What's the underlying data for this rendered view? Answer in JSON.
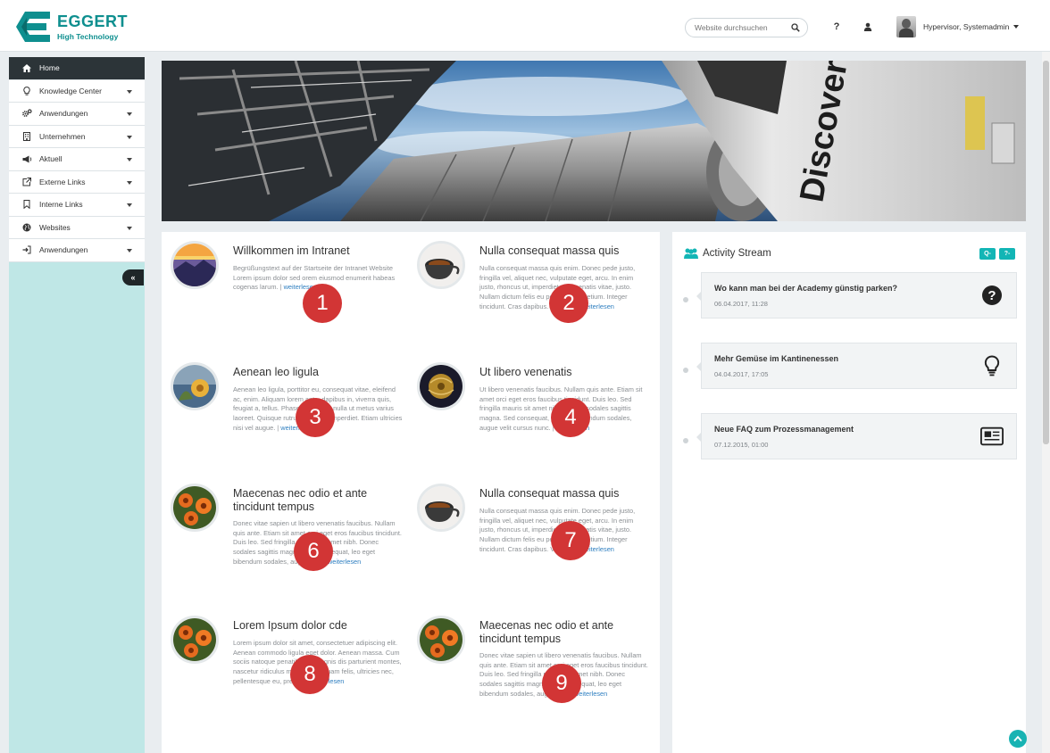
{
  "brand": {
    "name": "EGGERT",
    "tagline": "High Technology"
  },
  "header": {
    "search_placeholder": "Website durchsuchen",
    "help_icon": "question-icon",
    "user_icon": "user-icon",
    "user_name": "Hypervisor, Systemadmin"
  },
  "sidebar": {
    "items": [
      {
        "label": "Home",
        "icon": "home-icon",
        "active": true
      },
      {
        "label": "Knowledge Center",
        "icon": "lightbulb-icon"
      },
      {
        "label": "Anwendungen",
        "icon": "gears-icon"
      },
      {
        "label": "Unternehmen",
        "icon": "building-icon"
      },
      {
        "label": "Aktuell",
        "icon": "megaphone-icon"
      },
      {
        "label": "Externe Links",
        "icon": "external-link-icon"
      },
      {
        "label": "Interne Links",
        "icon": "bookmark-icon"
      },
      {
        "label": "Websites",
        "icon": "globe-icon"
      },
      {
        "label": "Anwendungen",
        "icon": "sign-in-icon"
      }
    ],
    "collapse_label": "«"
  },
  "articles": [
    {
      "title": "Willkommen im Intranet",
      "text": "Begrüßungstext auf der Startseite der Intranet Website Lorem ipsum dolor sed orem eiusmod enumerit habeas cogenas larum. |",
      "more": "weiterlesen",
      "badge": "1",
      "thumb": "mountain-sunset-icon"
    },
    {
      "title": "Nulla consequat massa quis",
      "text": "Nulla consequat massa quis enim. Donec pede justo, fringilla vel, aliquet nec, vulputate eget, arcu. In enim justo, rhoncus ut, imperdiet a, venenatis vitae, justo. Nullam dictum felis eu pede mollis pretium. Integer tincidunt. Cras dapibus. Vivamus |",
      "more": "weiterlesen",
      "badge": "2",
      "thumb": "coffee-cup-icon"
    },
    {
      "title": "Aenean leo ligula",
      "text": "Aenean leo ligula, porttitor eu, consequat vitae, eleifend ac, enim. Aliquam lorem ante, dapibus in, viverra quis, feugiat a, tellus. Phasellus viverra nulla ut metus varius laoreet. Quisque rutrum. Aenean imperdiet. Etiam ultricies nisi vel augue. |",
      "more": "weiterlesen",
      "badge": "3",
      "thumb": "flower-icon"
    },
    {
      "title": "Ut libero venenatis",
      "text": "Ut libero venenatis faucibus. Nullam quis ante. Etiam sit amet orci eget eros faucibus tincidunt. Duis leo. Sed fringilla mauris sit amet nibh. Donec sodales sagittis magna. Sed consequat, leo eget bibendum sodales, augue velit cursus nunc. |",
      "more": "weiterlesen",
      "badge": "4",
      "thumb": "globe-chair-icon"
    },
    {
      "title": "Maecenas nec odio et ante tincidunt tempus",
      "text": "Donec vitae sapien ut libero venenatis faucibus. Nullam quis ante. Etiam sit amet orci eget eros faucibus tincidunt. Duis leo. Sed fringilla mauris sit amet nibh. Donec sodales sagittis magna. Sed consequat, leo eget bibendum sodales, augue velit |",
      "more": "weiterlesen",
      "badge": "6",
      "thumb": "orange-flowers-icon"
    },
    {
      "title": "Nulla consequat massa quis",
      "text": "Nulla consequat massa quis enim. Donec pede justo, fringilla vel, aliquet nec, vulputate eget, arcu. In enim justo, rhoncus ut, imperdiet a, venenatis vitae, justo. Nullam dictum felis eu pede mollis pretium. Integer tincidunt. Cras dapibus. Vivamus |",
      "more": "weiterlesen",
      "badge": "7",
      "thumb": "coffee-cup-icon"
    },
    {
      "title": "Lorem Ipsum dolor cde",
      "text": "Lorem ipsum dolor sit amet, consectetuer adipiscing elit. Aenean commodo ligula eget dolor. Aenean massa. Cum sociis natoque penatibus et magnis dis parturient montes, nascetur ridiculus mus. Donec quam felis, ultricies nec, pellentesque eu, pretium |",
      "more": "weiterlesen",
      "badge": "8",
      "thumb": "orange-flowers-icon"
    },
    {
      "title": "Maecenas nec odio et ante tincidunt tempus",
      "text": "Donec vitae sapien ut libero venenatis faucibus. Nullam quis ante. Etiam sit amet orci eget eros faucibus tincidunt. Duis leo. Sed fringilla mauris sit amet nibh. Donec sodales sagittis magna. Sed consequat, leo eget bibendum sodales, augue velit |",
      "more": "weiterlesen",
      "badge": "9",
      "thumb": "orange-flowers-icon"
    }
  ],
  "activity": {
    "title": "Activity Stream",
    "buttons": [
      "Q-",
      "?-"
    ],
    "items": [
      {
        "title": "Wo kann man bei der Academy günstig parken?",
        "date": "06.04.2017, 11:28",
        "icon": "question-circle-icon"
      },
      {
        "title": "Mehr Gemüse im Kantinenessen",
        "date": "04.04.2017, 17:05",
        "icon": "lightbulb-icon"
      },
      {
        "title": "Neue FAQ zum Prozessmanagement",
        "date": "07.12.2015, 01:00",
        "icon": "newspaper-icon"
      }
    ]
  },
  "colors": {
    "brand": "#0e8f8f",
    "accent": "#12b5b5",
    "sidebar_bg": "#bfe7e6",
    "active_nav": "#2c3438",
    "badge": "#d23535",
    "link": "#2f7fc0"
  }
}
